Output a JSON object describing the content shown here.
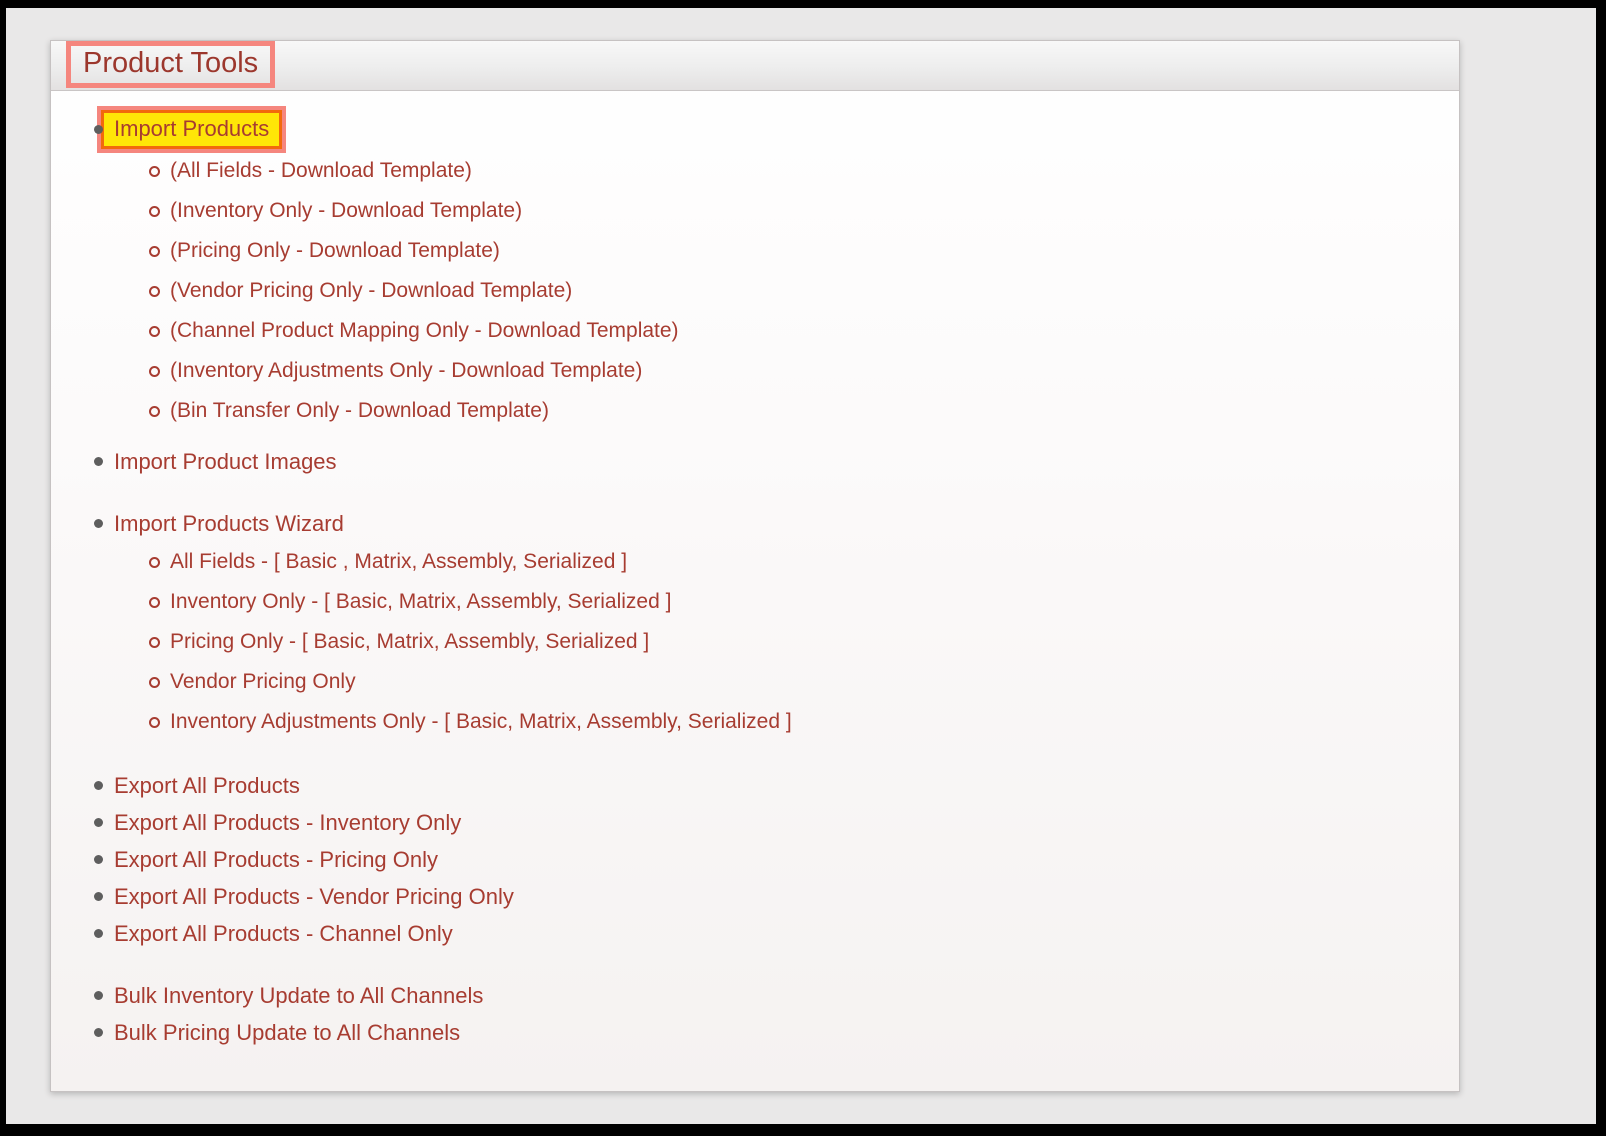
{
  "page": {
    "title": "Product Tools",
    "colors": {
      "link_red": "#a73c31",
      "title_red": "#9c372d",
      "highlight_yellow_fill": "#ffe607",
      "highlight_orange_border": "#f2690c",
      "annotation_salmon_border": "#f5867e",
      "bullet_gray": "#5e5e5e",
      "panel_background_top": "#ffffff",
      "panel_background_bottom": "#f5f2f1",
      "page_background": "#e9e8e8"
    }
  },
  "menu": {
    "groups": [
      {
        "items": [
          {
            "label": "Import Products",
            "highlighted": true,
            "children": [
              "(All Fields - Download Template)",
              "(Inventory Only - Download Template)",
              "(Pricing Only - Download Template)",
              "(Vendor Pricing Only - Download Template)",
              "(Channel Product Mapping Only - Download Template)",
              "(Inventory Adjustments Only - Download Template)",
              "(Bin Transfer Only - Download Template)"
            ]
          },
          {
            "label": "Import Product Images"
          }
        ]
      },
      {
        "items": [
          {
            "label": "Import Products Wizard",
            "children": [
              "All Fields - [ Basic , Matrix, Assembly, Serialized ]",
              "Inventory Only - [ Basic, Matrix, Assembly, Serialized ]",
              "Pricing Only - [ Basic, Matrix, Assembly, Serialized ]",
              "Vendor Pricing Only",
              "Inventory Adjustments Only - [ Basic, Matrix, Assembly, Serialized ]"
            ]
          }
        ]
      },
      {
        "items": [
          {
            "label": "Export All Products"
          },
          {
            "label": "Export All Products - Inventory Only"
          },
          {
            "label": "Export All Products - Pricing Only"
          },
          {
            "label": "Export All Products - Vendor Pricing Only"
          },
          {
            "label": "Export All Products - Channel Only"
          }
        ]
      },
      {
        "items": [
          {
            "label": "Bulk Inventory Update to All Channels"
          },
          {
            "label": "Bulk Pricing Update to All Channels"
          }
        ]
      }
    ]
  }
}
